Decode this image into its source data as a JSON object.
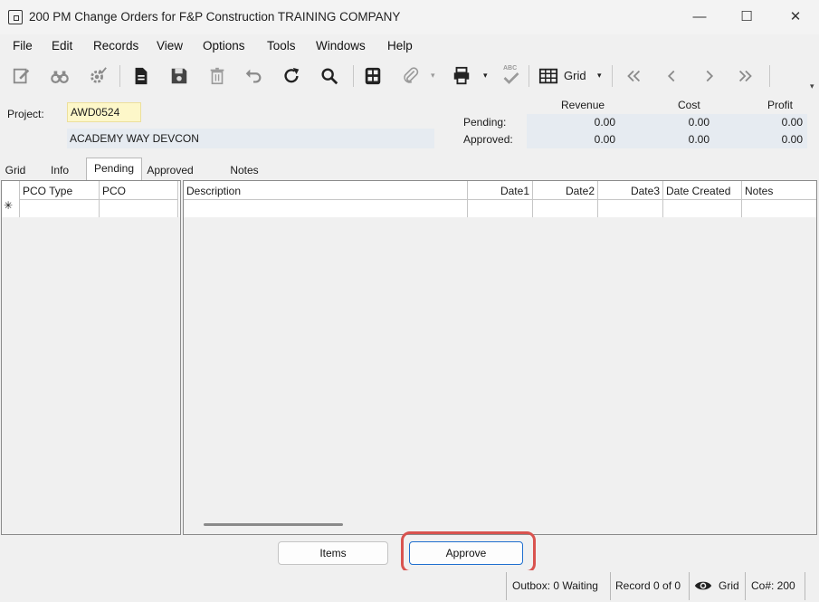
{
  "window": {
    "title": "200 PM Change Orders for F&P Construction TRAINING COMPANY",
    "minimize": "—",
    "maximize": "☐",
    "close": "✕"
  },
  "menu": [
    "File",
    "Edit",
    "Records",
    "View",
    "Options",
    "Tools",
    "Windows",
    "Help"
  ],
  "toolbar": {
    "grid_label": "Grid",
    "spell_label": "ABC"
  },
  "header": {
    "project_label": "Project:",
    "project_code": "AWD0524",
    "project_name": "ACADEMY WAY DEVCON",
    "columns": [
      "Revenue",
      "Cost",
      "Profit"
    ],
    "rows": [
      {
        "label": "Pending:",
        "revenue": "0.00",
        "cost": "0.00",
        "profit": "0.00"
      },
      {
        "label": "Approved:",
        "revenue": "0.00",
        "cost": "0.00",
        "profit": "0.00"
      }
    ]
  },
  "tabs": [
    "Grid",
    "Info",
    "Pending",
    "Approved",
    "Notes"
  ],
  "active_tab": "Pending",
  "left_grid": {
    "columns": [
      "PCO Type",
      "PCO"
    ],
    "new_row_marker": "✳"
  },
  "right_grid": {
    "columns": [
      "Description",
      "Date1",
      "Date2",
      "Date3",
      "Date Created",
      "Notes"
    ]
  },
  "buttons": {
    "items": "Items",
    "approve": "Approve"
  },
  "status": {
    "outbox": "Outbox: 0 Waiting",
    "record": "Record 0 of 0",
    "view": "Grid",
    "company": "Co#: 200"
  }
}
